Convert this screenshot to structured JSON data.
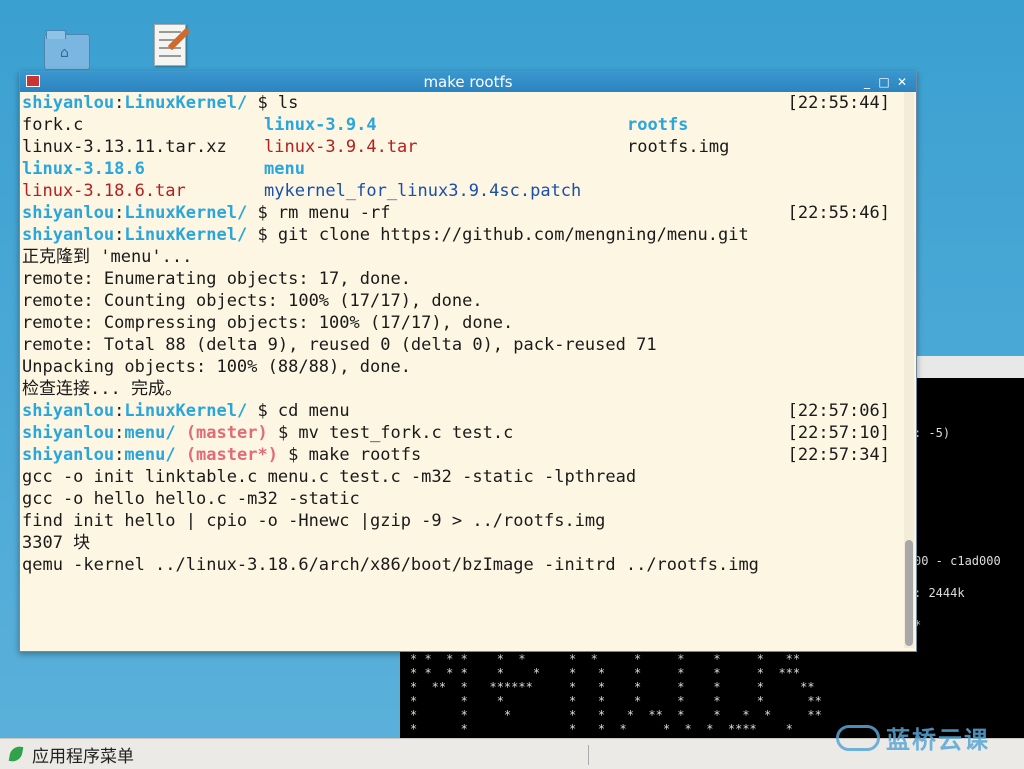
{
  "desktop": {
    "icons": [
      {
        "name": "home-folder-icon"
      },
      {
        "name": "text-editor-icon"
      }
    ]
  },
  "background_terminal": {
    "line1": ": -5)",
    "line2": "00 - c1ad000",
    "line3": ": 2444k",
    "line4": "*",
    "stars": "* *  * *    *  *      *  *     *     *    *     *   **\n* *  * *    *    *    *   *    *     *    *     *  ***\n*  **  *   ******     *   *    *     *    *     *     **\n*      *    *         *   *    *     *    *     *      **\n*      *     *        *   *   *  **  *    *   *  *     **\n*      *              *   *  *     *  *  *  ****    *"
  },
  "terminal": {
    "title": "make rootfs",
    "buttons": {
      "minimize": "_",
      "maximize": "□",
      "close": "✕"
    },
    "prompt_user": "shiyanlou",
    "colon": ":",
    "dollar": " $ ",
    "lines": {
      "l1": {
        "path": "LinuxKernel/",
        "cmd": "ls",
        "time": "[22:55:44]"
      },
      "ls": {
        "r1": [
          "fork.c",
          "linux-3.9.4",
          "rootfs"
        ],
        "r2": [
          "linux-3.13.11.tar.xz",
          "linux-3.9.4.tar",
          "rootfs.img"
        ],
        "r3": [
          "linux-3.18.6",
          "menu"
        ],
        "r4": [
          "linux-3.18.6.tar",
          "mykernel_for_linux3.9.4sc.patch"
        ]
      },
      "l6": {
        "path": "LinuxKernel/",
        "cmd": "rm menu -rf",
        "time": "[22:55:46]"
      },
      "l7": {
        "path": "LinuxKernel/",
        "cmd": "git clone https://github.com/mengning/menu.git"
      },
      "out1": "正克隆到 'menu'...",
      "out2": "remote: Enumerating objects: 17, done.",
      "out3": "remote: Counting objects: 100% (17/17), done.",
      "out4": "remote: Compressing objects: 100% (17/17), done.",
      "out5": "remote: Total 88 (delta 9), reused 0 (delta 0), pack-reused 71",
      "out6": "Unpacking objects: 100% (88/88), done.",
      "out7": "检查连接... 完成。",
      "l15": {
        "path": "LinuxKernel/",
        "cmd": "cd menu",
        "time": "[22:57:06]"
      },
      "l16": {
        "path": "menu/",
        "branch": "(master)",
        "cmd": "mv test_fork.c test.c",
        "time": "[22:57:10]"
      },
      "l17": {
        "path": "menu/",
        "branch": "(master*)",
        "cmd": "make rootfs",
        "time": "[22:57:34]"
      },
      "out8": "gcc -o init linktable.c menu.c test.c -m32 -static -lpthread",
      "out9": "gcc -o hello hello.c -m32 -static",
      "out10": "find init hello | cpio -o -Hnewc |gzip -9 > ../rootfs.img",
      "out11": "3307 块",
      "out12": "qemu -kernel ../linux-3.18.6/arch/x86/boot/bzImage -initrd ../rootfs.img"
    }
  },
  "taskbar": {
    "apps_menu": "应用程序菜单"
  },
  "watermark": {
    "text": "蓝桥云课"
  },
  "colors": {
    "terminal_bg": "#fdf6e3",
    "prompt_blue": "#2aa6dc",
    "branch_red": "#e06c75",
    "archive_red": "#b3201f",
    "titlebar": "#3a96cf"
  }
}
